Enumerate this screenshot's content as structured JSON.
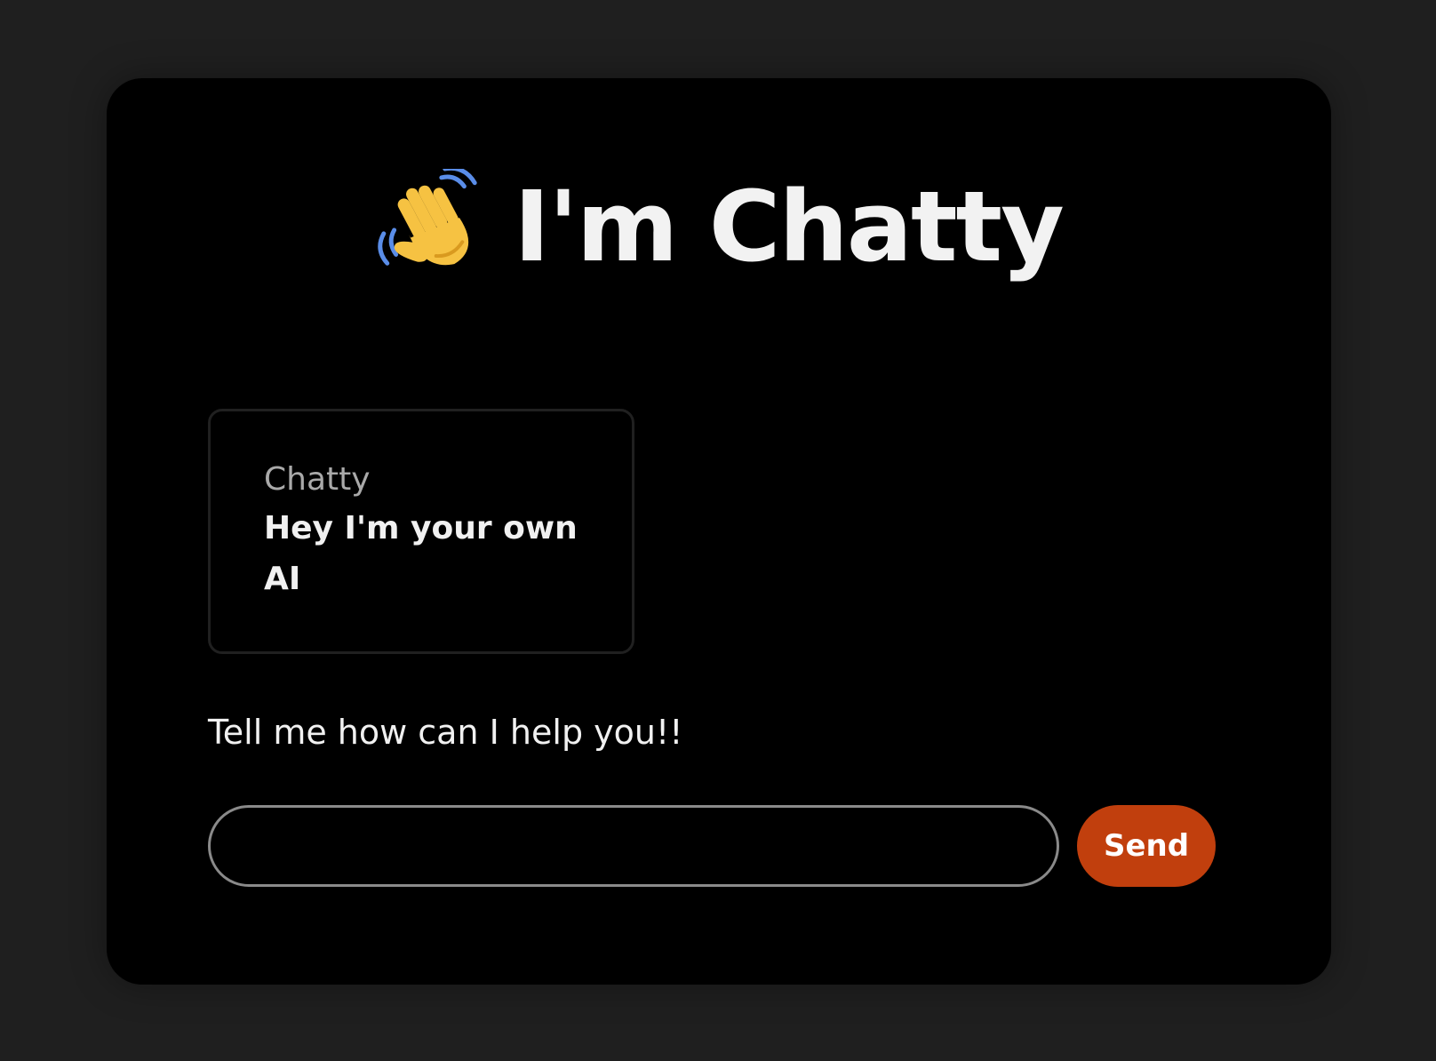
{
  "header": {
    "title": "I'm Chatty",
    "icon": "waving-hand-icon",
    "icon_colors": {
      "hand": "#f6c242",
      "hand_shade": "#d99a1f",
      "motion_lines": "#5a8de8"
    }
  },
  "messages": [
    {
      "sender": "Chatty",
      "text": "Hey I'm your own AI"
    }
  ],
  "prompt": {
    "text": "Tell me how can I help you!!"
  },
  "input": {
    "value": "",
    "placeholder": ""
  },
  "send_button": {
    "label": "Send",
    "color": "#c13f0d"
  },
  "colors": {
    "page_background": "#1f1f1f",
    "card_background": "#000000",
    "text_primary": "#f1f1f1",
    "text_secondary": "#a9a9a9",
    "input_border": "#8a8a8a"
  }
}
